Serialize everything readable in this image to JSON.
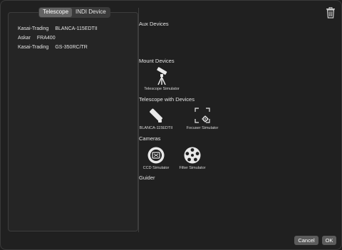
{
  "tabs": [
    {
      "label": "Telescope",
      "active": true
    },
    {
      "label": "INDI Device",
      "active": false
    }
  ],
  "telescopes": [
    {
      "vendor": "Kasai-Trading",
      "model": "BLANCA-115EDTII"
    },
    {
      "vendor": "Askar",
      "model": "FRA400"
    },
    {
      "vendor": "Kasai-Trading",
      "model": "GS-350RC/TR"
    }
  ],
  "sections": {
    "aux": "Aux Devices",
    "mount": "Mount Devices",
    "telescope": "Telescope with Devices",
    "cameras": "Cameras",
    "guider": "Guider"
  },
  "devices": {
    "mount": {
      "label": "Telescope Simulator",
      "icon": "mount-icon"
    },
    "telescope": {
      "label": "BLANCA-115EDTII",
      "icon": "telescope-icon"
    },
    "focuser": {
      "label": "Focuser Simulator",
      "icon": "focuser-icon"
    },
    "ccd": {
      "label": "CCD Simulator",
      "icon": "ccd-camera-icon"
    },
    "filter": {
      "label": "Filter Simulator",
      "icon": "filter-wheel-icon"
    }
  },
  "buttons": {
    "cancel": "Cancel",
    "ok": "OK"
  },
  "icons": {
    "trash": "trash-icon"
  }
}
